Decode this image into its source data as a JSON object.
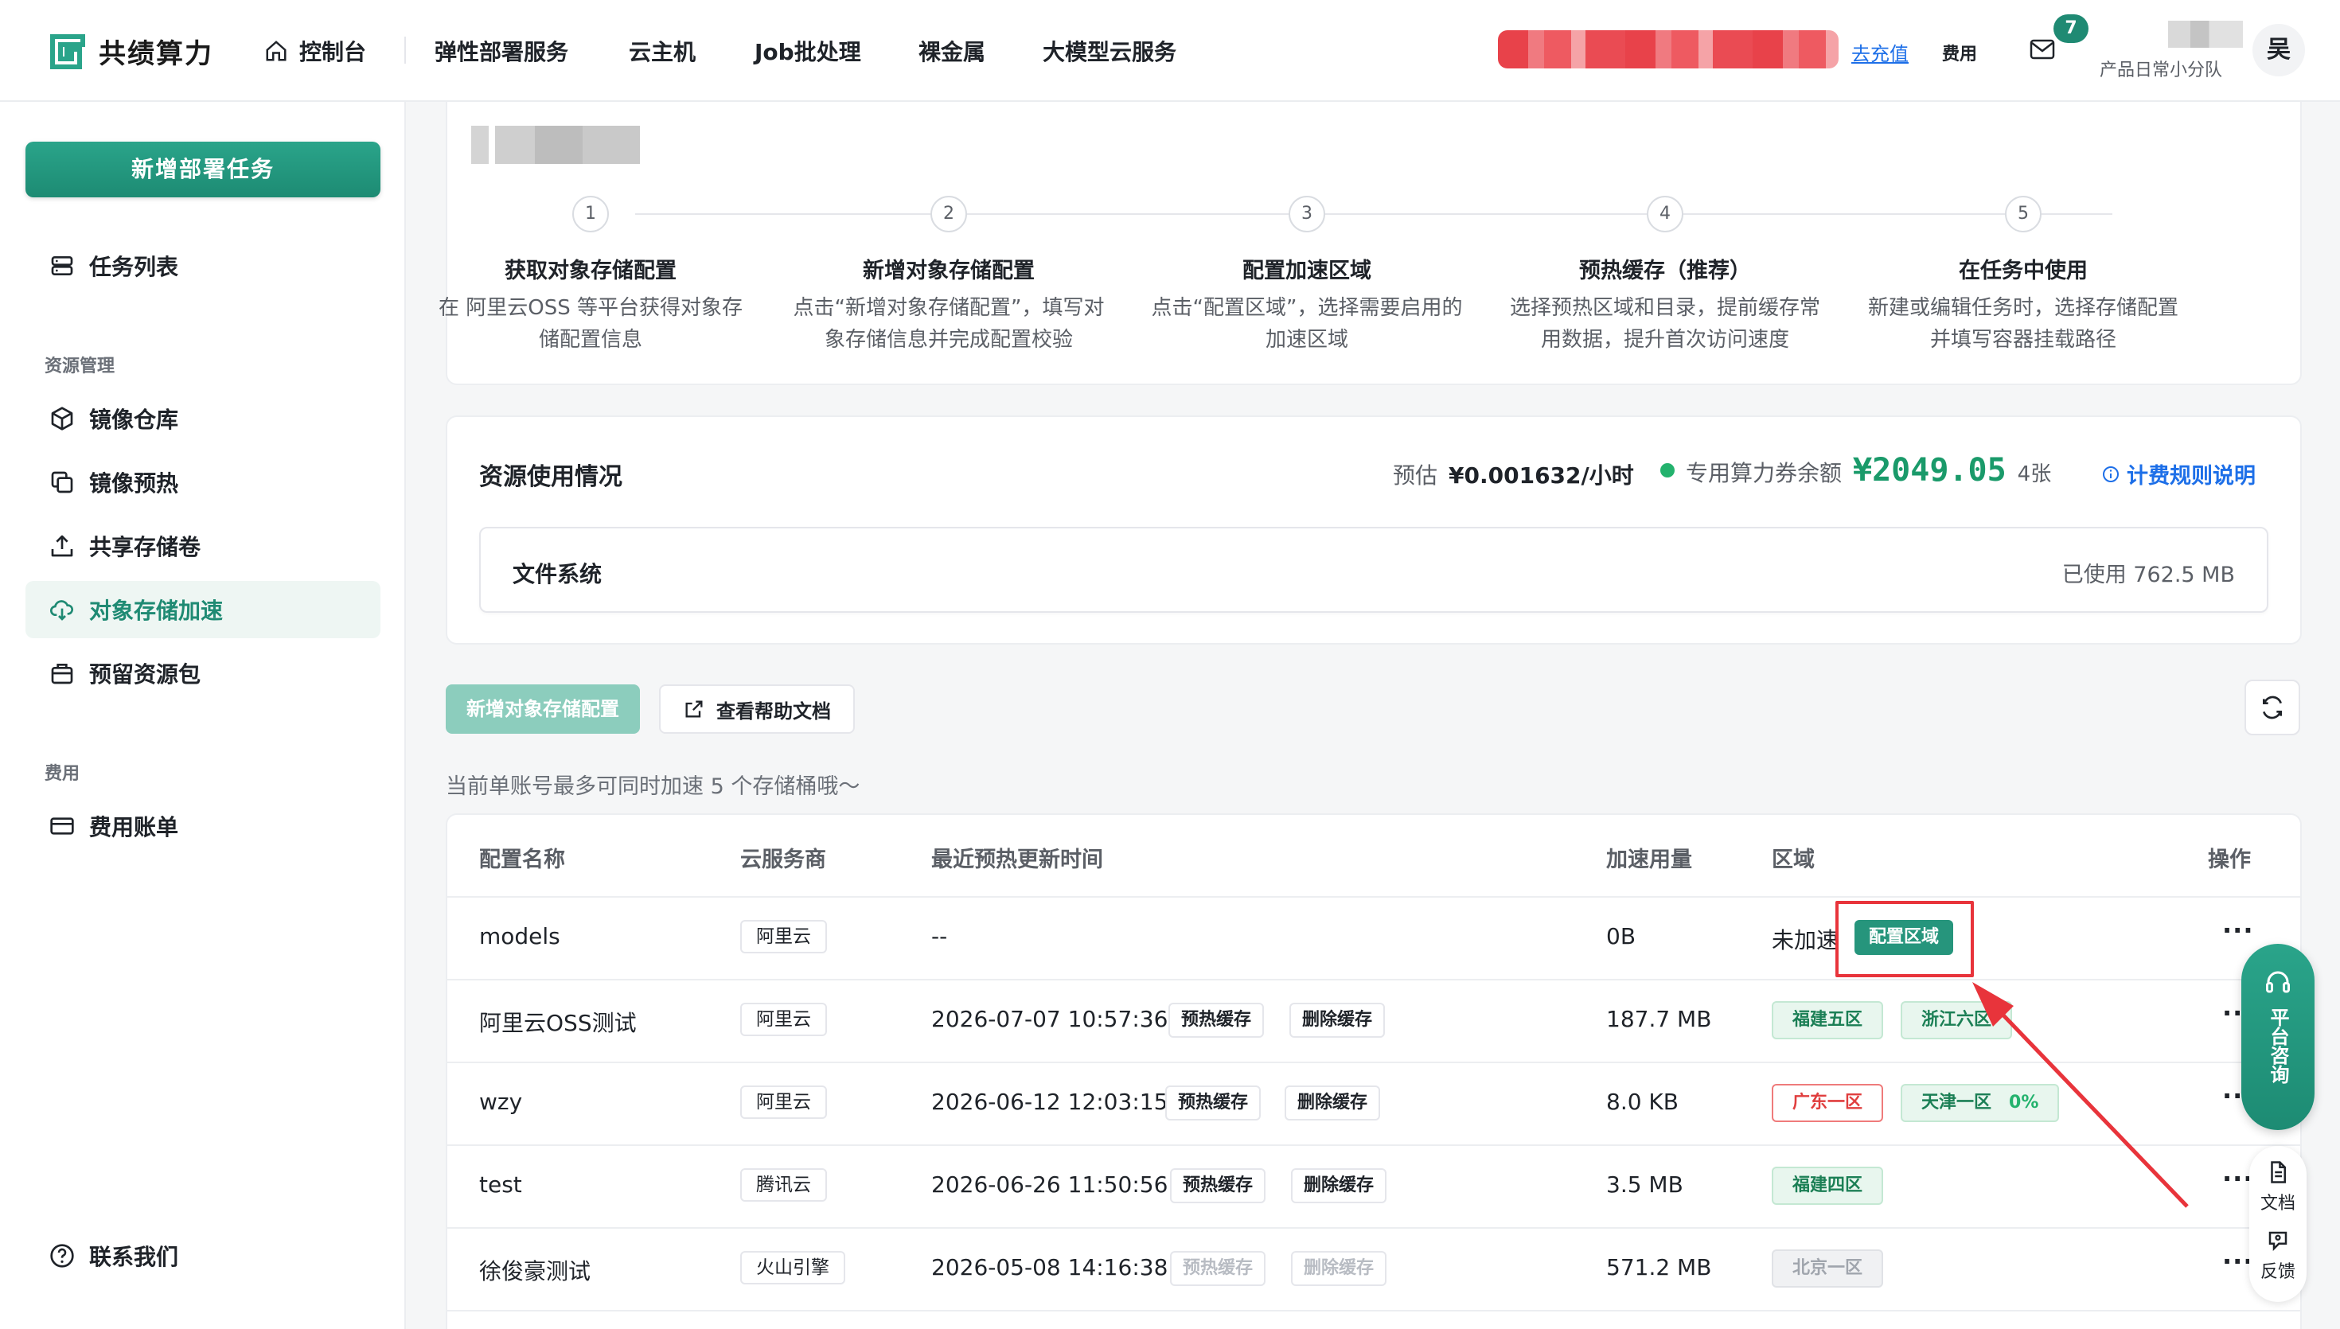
{
  "brand": {
    "name": "共绩算力"
  },
  "nav": {
    "items": [
      {
        "label": "控制台"
      },
      {
        "label": "弹性部署服务"
      },
      {
        "label": "云主机"
      },
      {
        "label": "Job批处理"
      },
      {
        "label": "裸金属"
      },
      {
        "label": "大模型云服务"
      }
    ],
    "recharge": "去充值",
    "fee": "费用",
    "mail_badge": "7",
    "team": "产品日常小分队",
    "avatar": "吴"
  },
  "sidebar": {
    "new_task": "新增部署任务",
    "task_list": "任务列表",
    "group_resource": "资源管理",
    "items": [
      {
        "label": "镜像仓库"
      },
      {
        "label": "镜像预热"
      },
      {
        "label": "共享存储卷"
      },
      {
        "label": "对象存储加速"
      },
      {
        "label": "预留资源包"
      }
    ],
    "group_fee": "费用",
    "bill": "费用账单",
    "contact": "联系我们"
  },
  "steps": [
    {
      "num": "1",
      "title": "获取对象存储配置",
      "desc": "在 阿里云OSS 等平台获得对象存储配置信息"
    },
    {
      "num": "2",
      "title": "新增对象存储配置",
      "desc": "点击“新增对象存储配置”，填写对象存储信息并完成配置校验"
    },
    {
      "num": "3",
      "title": "配置加速区域",
      "desc": "点击“配置区域”，选择需要启用的加速区域"
    },
    {
      "num": "4",
      "title": "预热缓存（推荐）",
      "desc": "选择预热区域和目录，提前缓存常用数据，提升首次访问速度"
    },
    {
      "num": "5",
      "title": "在任务中使用",
      "desc": "新建或编辑任务时，选择存储配置并填写容器挂载路径"
    }
  ],
  "usage": {
    "title": "资源使用情况",
    "estimate_label": "预估",
    "estimate_value": "¥0.001632/小时",
    "coupon_label": "专用算力券余额",
    "coupon_amount": "¥2049.05",
    "coupon_count": "4张",
    "billing_link": "计费规则说明",
    "fs_label": "文件系统",
    "fs_used": "已使用 762.5 MB"
  },
  "actions": {
    "new_config": "新增对象存储配置",
    "help_doc": "查看帮助文档",
    "hint": "当前单账号最多可同时加速 5 个存储桶哦～"
  },
  "table": {
    "headers": [
      "配置名称",
      "云服务商",
      "最近预热更新时间",
      "加速用量",
      "区域",
      "操作"
    ],
    "warm_label": "预热缓存",
    "delete_label": "删除缓存",
    "config_region_label": "配置区域",
    "not_accel": "未加速",
    "more": "···",
    "rows": [
      {
        "name": "models",
        "vendor": "阿里云",
        "time": "--",
        "usage": "0B"
      },
      {
        "name": "阿里云OSS测试",
        "vendor": "阿里云",
        "time": "2026-07-07 10:57:36",
        "usage": "187.7 MB",
        "regions": [
          "福建五区",
          "浙江六区"
        ]
      },
      {
        "name": "wzy",
        "vendor": "阿里云",
        "time": "2026-06-12 12:03:15",
        "usage": "8.0 KB",
        "regions": [
          "广东一区",
          "天津一区"
        ],
        "pct": "0%"
      },
      {
        "name": "test",
        "vendor": "腾讯云",
        "time": "2026-06-26 11:50:56",
        "usage": "3.5 MB",
        "regions": [
          "福建四区"
        ]
      },
      {
        "name": "徐俊豪测试",
        "vendor": "火山引擎",
        "time": "2026-05-08 14:16:38",
        "usage": "571.2 MB",
        "regions": [
          "北京一区"
        ]
      }
    ]
  },
  "float": {
    "consult": "平台咨询",
    "doc": "文档",
    "feedback": "反馈"
  },
  "colors": {
    "brand": "#1f8a73",
    "link": "#1d6fe8",
    "highlight": "#e8343b"
  }
}
